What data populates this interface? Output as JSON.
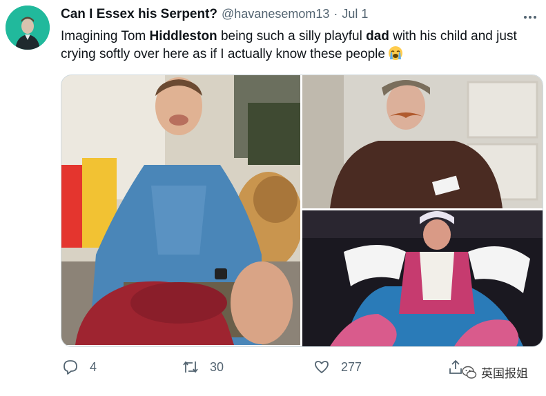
{
  "tweet": {
    "display_name": "Can I Essex his Serpent?",
    "handle": "@havanesemom13",
    "separator": "·",
    "date": "Jul 1",
    "text_parts": {
      "p1": "Imagining Tom ",
      "b1": "Hiddleston",
      "p2": " being such a silly playful ",
      "b2": "dad",
      "p3": " with his child and just crying softly over here as if I actually know these people"
    },
    "emoji": "loudly-crying-face"
  },
  "actions": {
    "reply_count": "4",
    "retweet_count": "30",
    "like_count": "277"
  },
  "watermark": {
    "text": "英国报姐"
  },
  "colors": {
    "text": "#0f1419",
    "secondary": "#536471",
    "border": "#cfd9de",
    "avatar_bg": "#1fb89b"
  }
}
